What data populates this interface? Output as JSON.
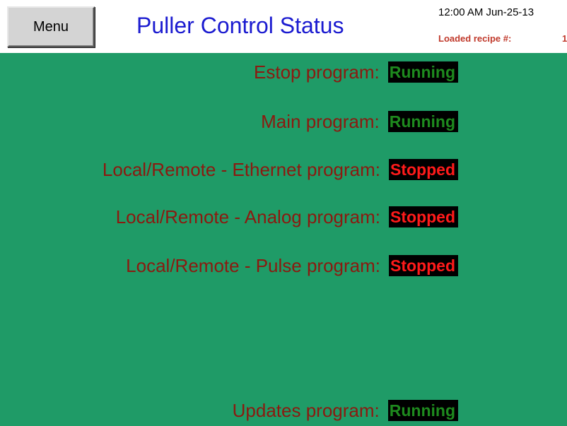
{
  "header": {
    "menu_label": "Menu",
    "title": "Puller Control Status",
    "clock": "12:00 AM Jun-25-13",
    "recipe_label": "Loaded recipe #:",
    "recipe_value": "1"
  },
  "programs": [
    {
      "label": "Estop program:",
      "status": "Running"
    },
    {
      "label": "Main program:",
      "status": "Running"
    },
    {
      "label": "Local/Remote - Ethernet program:",
      "status": "Stopped"
    },
    {
      "label": "Local/Remote - Analog program:",
      "status": "Stopped"
    },
    {
      "label": "Local/Remote - Pulse program:",
      "status": "Stopped"
    },
    {
      "label": "Updates program:",
      "status": "Running"
    }
  ],
  "colors": {
    "background": "#1f9b67",
    "title": "#1b1bd0",
    "label": "#8b1a10",
    "running": "#1e8a1e",
    "stopped": "#ff1a1a"
  }
}
